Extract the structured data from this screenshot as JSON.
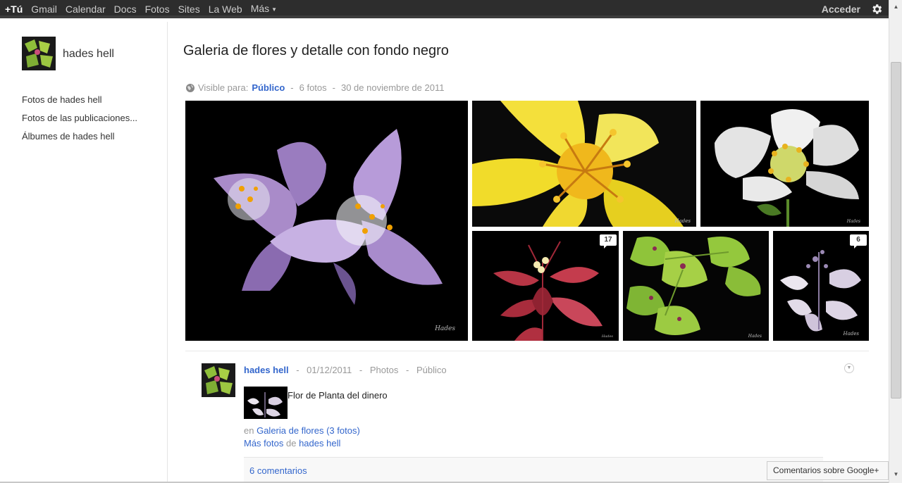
{
  "topbar": {
    "items": [
      {
        "label": "+Tú"
      },
      {
        "label": "Gmail"
      },
      {
        "label": "Calendar"
      },
      {
        "label": "Docs"
      },
      {
        "label": "Fotos"
      },
      {
        "label": "Sites"
      },
      {
        "label": "La Web"
      },
      {
        "label": "Más"
      }
    ],
    "signin_label": "Acceder",
    "settings_icon": "gear-icon"
  },
  "sidebar": {
    "owner_name": "hades hell",
    "links": [
      {
        "label": "Fotos de hades hell"
      },
      {
        "label": "Fotos de las publicaciones..."
      },
      {
        "label": "Álbumes de hades hell"
      }
    ]
  },
  "album": {
    "title": "Galeria de flores y detalle con fondo negro",
    "visible_label": "Visible para:",
    "visibility": "Público",
    "photo_count": "6 fotos",
    "date": "30 de noviembre de 2011",
    "photos": [
      {
        "subject": "purple flower",
        "signature": "Hades"
      },
      {
        "subject": "yellow flower",
        "signature": "Hades"
      },
      {
        "subject": "white flower",
        "signature": "Hades"
      },
      {
        "subject": "red leaves flower",
        "comments": "17",
        "signature": "Hades"
      },
      {
        "subject": "green leaves",
        "signature": "Hades"
      },
      {
        "subject": "white leaves flower",
        "comments": "6",
        "signature": "Hades"
      }
    ]
  },
  "post": {
    "author": "hades hell",
    "date": "01/12/2011",
    "source": "Photos",
    "visibility": "Público",
    "caption": "Flor de Planta del dinero",
    "in_label": "en",
    "album_link": "Galeria de flores (3 fotos)",
    "more_photos": "Más fotos",
    "of_label": "de",
    "more_author": "hades hell",
    "comments_label": "6 comentarios"
  },
  "feedback_label": "Comentarios sobre Google+",
  "colors": {
    "link": "#3366cc",
    "topbar": "#2d2d2d"
  }
}
